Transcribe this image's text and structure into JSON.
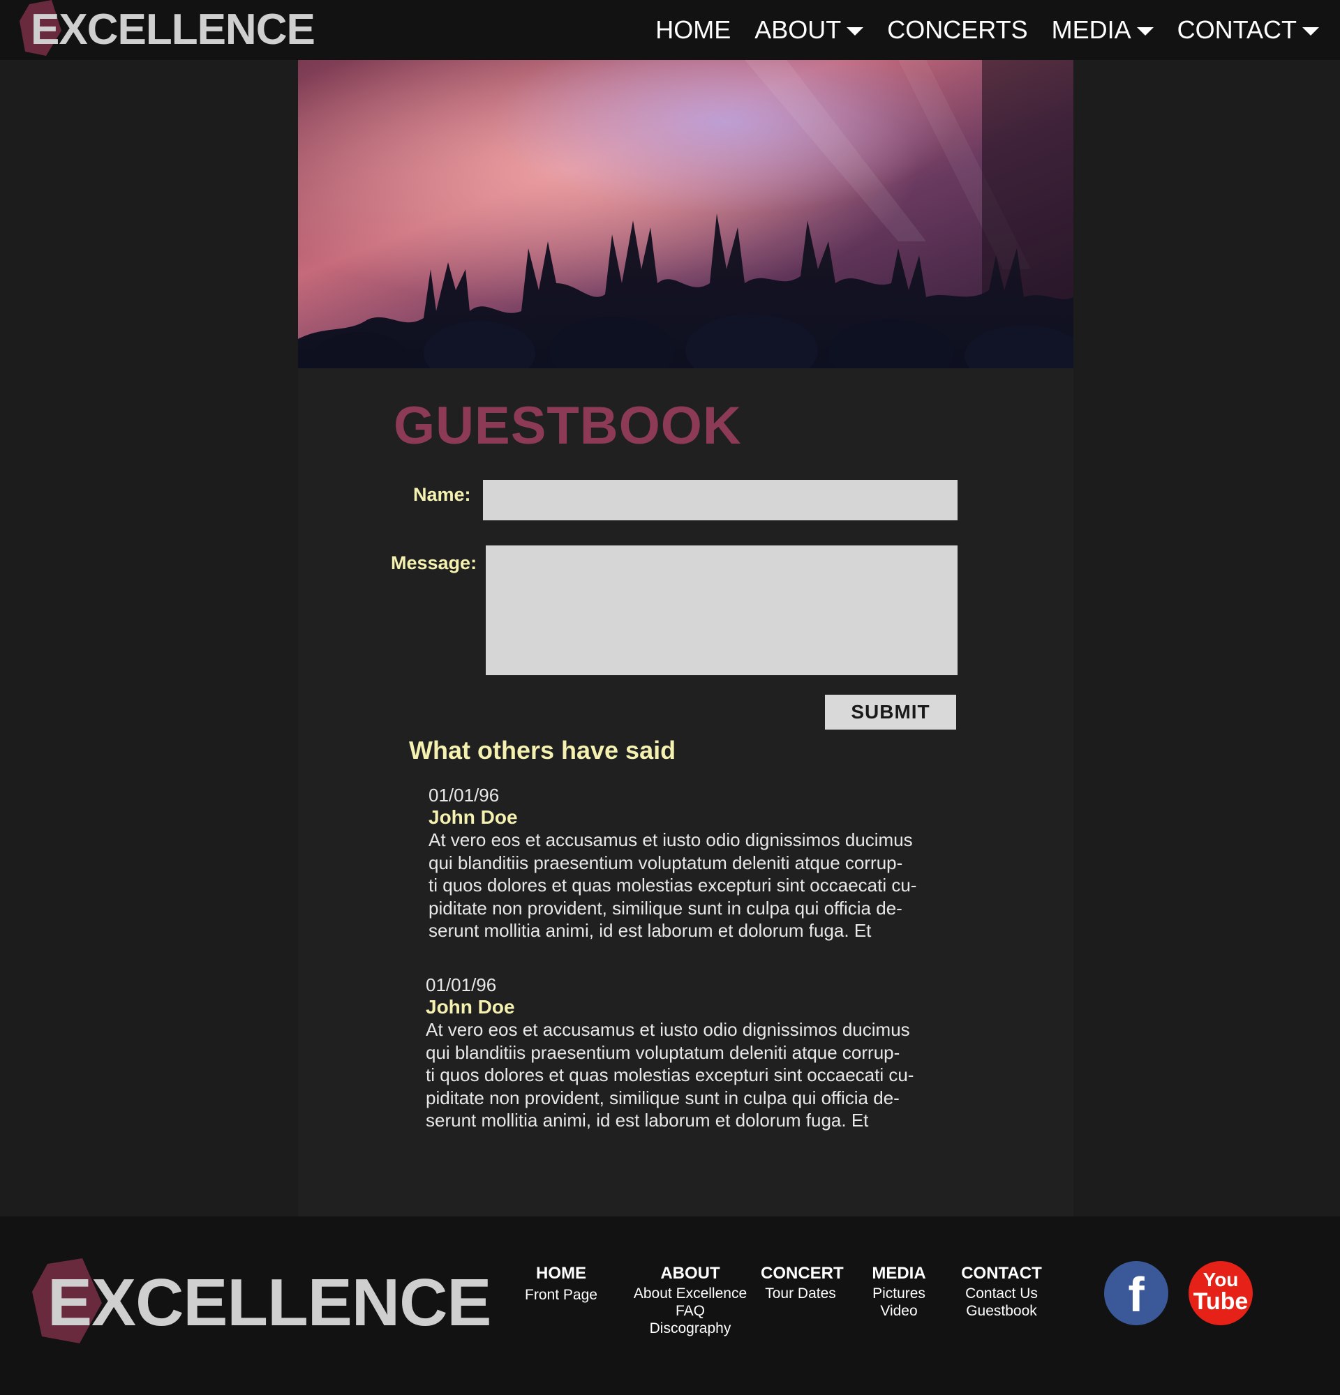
{
  "brand": {
    "name": "EXCELLENCE",
    "hex_color": "#6a2a3e",
    "text_color": "#cfcfcf"
  },
  "nav": {
    "items": [
      {
        "label": "HOME",
        "has_dropdown": false
      },
      {
        "label": "ABOUT",
        "has_dropdown": true
      },
      {
        "label": "CONCERTS",
        "has_dropdown": false
      },
      {
        "label": "MEDIA",
        "has_dropdown": true
      },
      {
        "label": "CONTACT",
        "has_dropdown": true
      }
    ]
  },
  "hero": {
    "icon": "concert-crowd-image"
  },
  "page": {
    "title": "GUESTBOOK",
    "title_color": "#8c3a55"
  },
  "form": {
    "name_label": "Name:",
    "name_value": "",
    "message_label": "Message:",
    "message_value": "",
    "submit_label": "SUBMIT"
  },
  "comments": {
    "heading": "What others have said",
    "entries": [
      {
        "date": "01/01/96",
        "author": "John Doe",
        "text": "At vero eos et accusamus et iusto odio dignissimos ducimus qui blanditiis praesentium voluptatum deleniti atque corrup-ti quos dolores et quas molestias excepturi sint occaecati cu-piditate non provident, similique sunt in culpa qui officia de-serunt mollitia animi, id est laborum et dolorum fuga. Et",
        "lines": [
          "At vero eos et accusamus et iusto odio dignissimos ducimus",
          "qui blanditiis praesentium voluptatum deleniti atque corrup-",
          "ti quos dolores et quas molestias excepturi sint occaecati cu-",
          "piditate non provident, similique sunt in culpa qui officia de-",
          "serunt mollitia animi, id est laborum et dolorum fuga. Et"
        ]
      },
      {
        "date": "01/01/96",
        "author": "John Doe",
        "text": "At vero eos et accusamus et iusto odio dignissimos ducimus qui blanditiis praesentium voluptatum deleniti atque corrup-ti quos dolores et quas molestias excepturi sint occaecati cu-piditate non provident, similique sunt in culpa qui officia de-serunt mollitia animi, id est laborum et dolorum fuga. Et",
        "lines": [
          "At vero eos et accusamus et iusto odio dignissimos ducimus",
          "qui blanditiis praesentium voluptatum deleniti atque corrup-",
          "ti quos dolores et quas molestias excepturi sint occaecati cu-",
          "piditate non provident, similique sunt in culpa qui officia de-",
          "serunt mollitia animi, id est laborum et dolorum fuga. Et"
        ]
      }
    ]
  },
  "footer": {
    "columns": [
      {
        "heading": "HOME",
        "links": [
          "Front Page"
        ]
      },
      {
        "heading": "ABOUT",
        "links": [
          "About Excellence",
          "FAQ",
          "Discography"
        ]
      },
      {
        "heading": "CONCERT",
        "links": [
          "Tour Dates"
        ]
      },
      {
        "heading": "MEDIA",
        "links": [
          "Pictures",
          "Video"
        ]
      },
      {
        "heading": "CONTACT",
        "links": [
          "Contact Us",
          "Guestbook"
        ]
      }
    ],
    "social": {
      "facebook": {
        "icon": "facebook-icon",
        "glyph": "f",
        "color": "#3b5998"
      },
      "youtube": {
        "icon": "youtube-icon",
        "glyph_top": "You",
        "glyph_bottom": "Tube",
        "color": "#e62117"
      }
    }
  },
  "colors": {
    "page_bg": "#1c1c1c",
    "bar_bg": "#121212",
    "panel_bg": "#202020",
    "accent_yellow": "#f4f1b1",
    "input_bg": "#d6d6d6"
  }
}
